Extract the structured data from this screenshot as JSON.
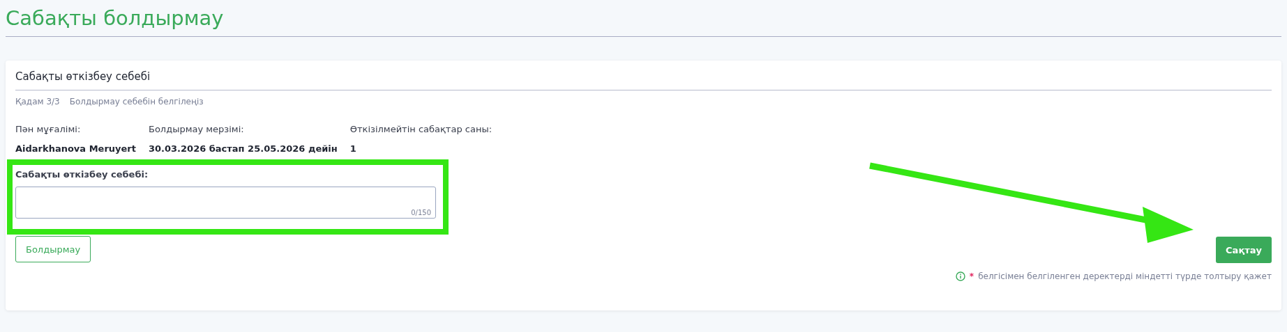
{
  "page": {
    "title": "Сабақты болдырмау"
  },
  "card": {
    "title": "Сабақты өткізбеу себебі",
    "step": {
      "counter": "Қадам 3/3",
      "label": "Болдырмау себебін белгілеңіз"
    },
    "info": [
      {
        "label": "Пән мұғалімі:",
        "value": "Aidarkhanova Meruyert"
      },
      {
        "label": "Болдырмау мерзімі:",
        "value": "30.03.2026 бастап 25.05.2026 дейін"
      },
      {
        "label": "Өткізілмейтін сабақтар саны:",
        "value": "1"
      }
    ],
    "reason_field": {
      "label": "Сабақты өткізбеу себебі:",
      "counter": "0/150"
    },
    "buttons": [
      {
        "label": "Болдырмау",
        "kind": "outline"
      },
      {
        "label": "Сақтау",
        "kind": "primary"
      }
    ],
    "note": {
      "mark": "*",
      "text": "белгісімен белгіленген деректерді міндетті түрде толтыру қажет"
    }
  }
}
